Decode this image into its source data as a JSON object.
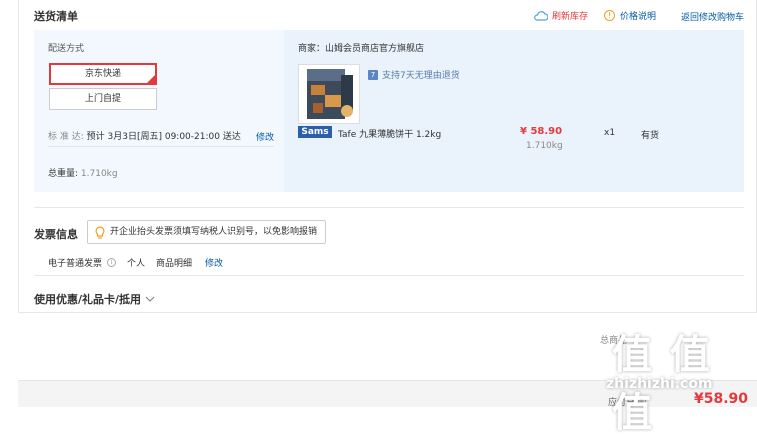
{
  "delivery": {
    "title": "送货清单",
    "refresh_stock": "刷新库存",
    "price_info": "价格说明",
    "back_to_cart": "返回修改购物车",
    "method_label": "配送方式",
    "methods": [
      "京东快递",
      "上门自提"
    ],
    "selected_method": "京东快递",
    "standard_label": "标 准 达:",
    "estimate": "预计 3月3日[周五] 09:00-21:00 送达",
    "modify": "修改",
    "total_weight_label": "总重量:",
    "total_weight": "1.710kg"
  },
  "seller": {
    "label": "商家：",
    "name": "山姆会员商店官方旗舰店",
    "return_policy": "支持7天无理由退货",
    "return_badge": "7",
    "brand_logo": "Sams"
  },
  "product": {
    "name": "Tafe 九果薄脆饼干 1.2kg",
    "price": "¥ 58.90",
    "weight": "1.710kg",
    "qty": "x1",
    "stock": "有货"
  },
  "invoice": {
    "title": "发票信息",
    "tip": "开企业抬头发票须填写纳税人识别号，以免影响报销",
    "type": "电子普通发票",
    "holder": "个人",
    "detail": "商品明细",
    "modify": "修改"
  },
  "coupon": {
    "title": "使用优惠/礼品卡/抵用"
  },
  "summary": {
    "total_label": "总商品",
    "payable_label": "应付总额:",
    "payable": "¥58.90"
  },
  "watermark": {
    "text": "值 值 值",
    "site": "zhizhizhi.com"
  },
  "colors": {
    "accent_red": "#e4393c",
    "link_blue": "#005aa0",
    "panel_blue": "#f3f8fe"
  }
}
